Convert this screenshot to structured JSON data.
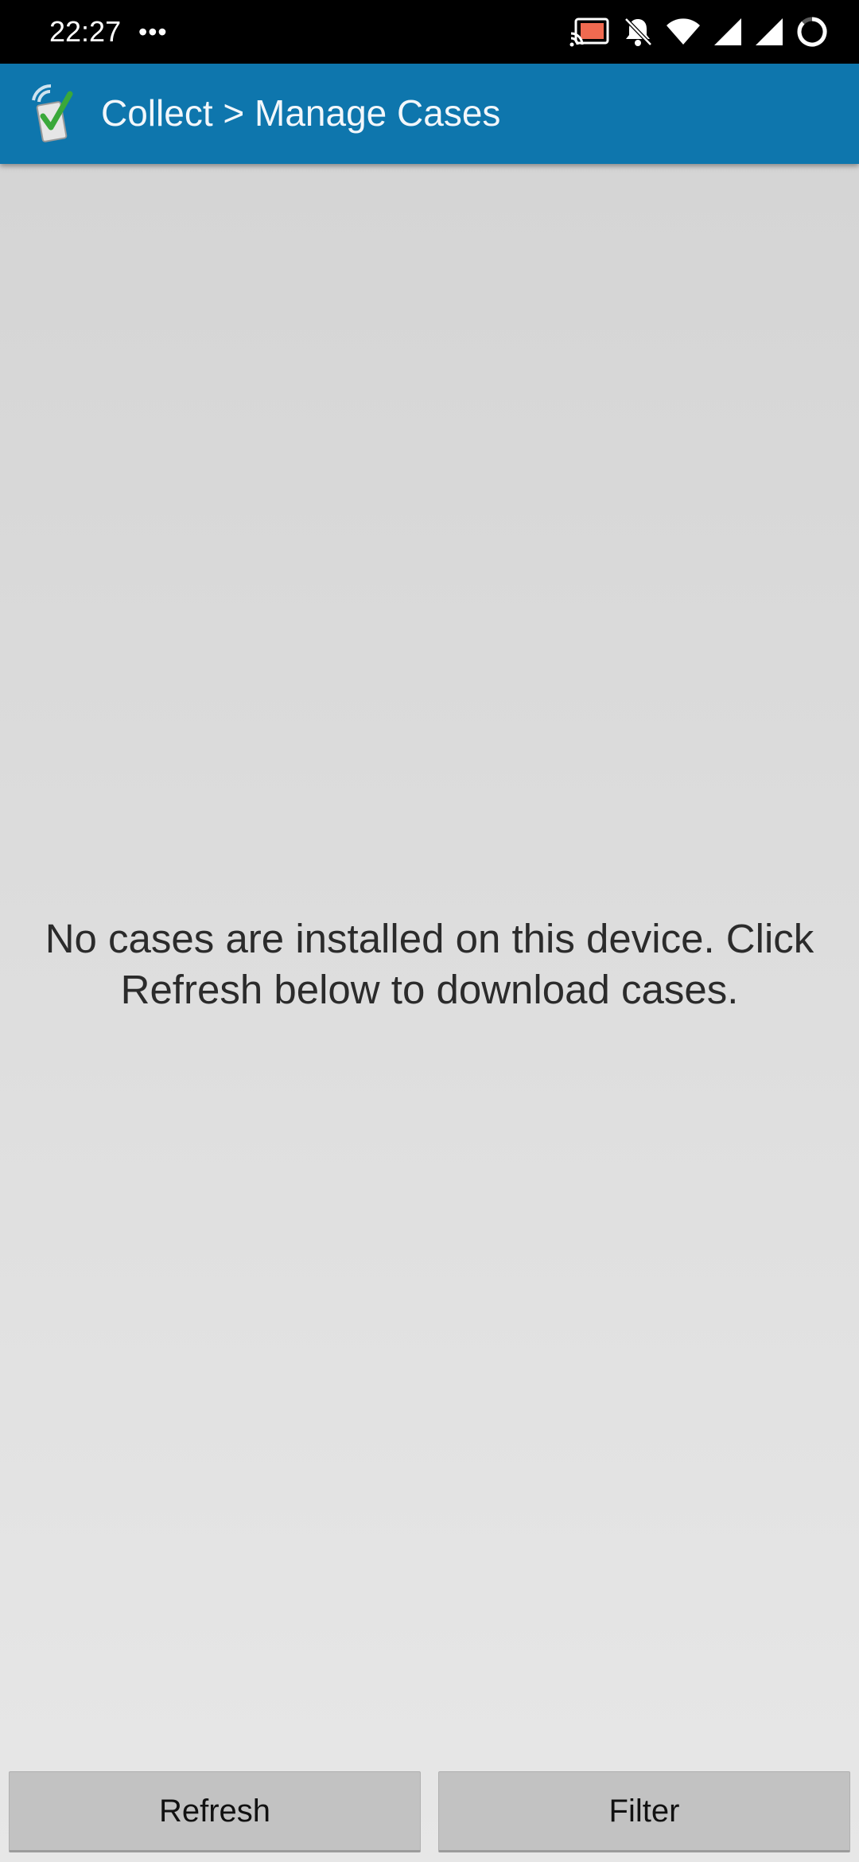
{
  "status_bar": {
    "time": "22:27",
    "dots": "•••",
    "icons": [
      "cast-icon",
      "bell-off-icon",
      "wifi-icon",
      "signal-icon",
      "signal-icon-2",
      "battery-ring-icon"
    ]
  },
  "app_bar": {
    "title": "Collect > Manage Cases",
    "logo_icon": "collect-checkmark-logo",
    "color": "#0e76ad"
  },
  "main": {
    "empty_message": "No cases are installed on this device. Click Refresh below to download cases."
  },
  "buttons": {
    "refresh_label": "Refresh",
    "filter_label": "Filter"
  }
}
